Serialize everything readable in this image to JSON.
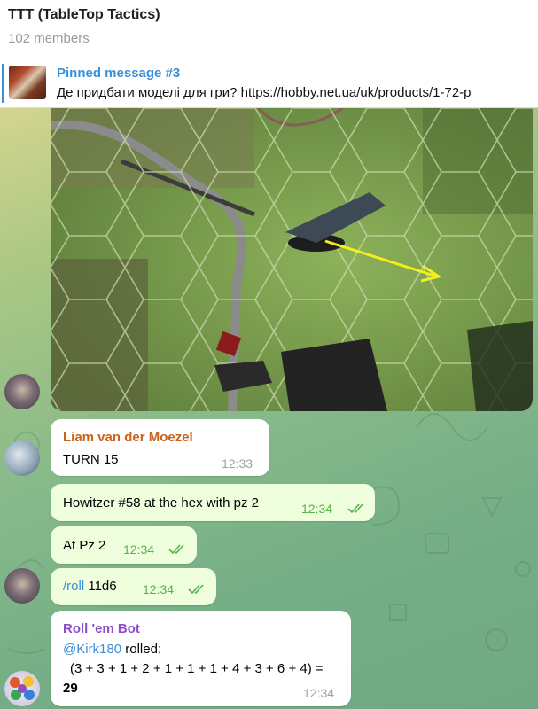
{
  "header": {
    "title": "TTT (TableTop Tactics)",
    "members": "102 members"
  },
  "pinned": {
    "title": "Pinned message #3",
    "text": "Де придбати моделі для гри?  https://hobby.net.ua/uk/products/1-72-p"
  },
  "messages": [
    {
      "sender": "Liam van der Moezel",
      "text": "TURN 15",
      "time": "12:33"
    },
    {
      "text": "Howitzer #58 at the hex with pz 2",
      "time": "12:34"
    },
    {
      "text": "At Pz 2",
      "time": "12:34"
    },
    {
      "command": "/roll",
      "args": " 11d6",
      "time": "12:34"
    },
    {
      "sender": "Roll 'em Bot",
      "mention": "@Kirk180",
      "rolled": " rolled:",
      "formula": "(3 + 3 + 1 + 2 + 1 + 1 + 1 + 4 + 3 + 6 + 4) =",
      "result": "29",
      "time": "12:34"
    }
  ],
  "colors": {
    "sender_liam": "#c8631e",
    "sender_bot": "#8a4fc9",
    "link": "#3a8fd8",
    "read_ticks": "#55b34a"
  },
  "icons": [
    "pin-thumbnail",
    "read-checkmarks-icon",
    "group-avatar",
    "plane-avatar",
    "dice-bot-avatar"
  ]
}
